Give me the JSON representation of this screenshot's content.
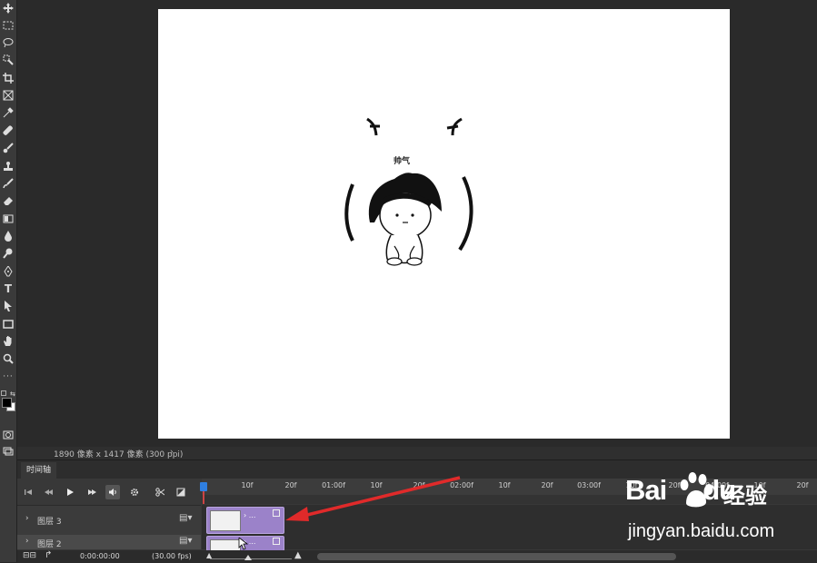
{
  "canvas": {
    "caption": "帅气",
    "background": "#ffffff"
  },
  "status_bar": {
    "doc_info": "1890 像素 x 1417 像素 (300 ppi)",
    "arrow": "›"
  },
  "timeline": {
    "tab_label": "时间轴",
    "ruler_labels": [
      "10f",
      "20f",
      "01:00f",
      "10f",
      "20f",
      "02:00f",
      "10f",
      "20f",
      "03:00f",
      "10f",
      "20f",
      "04:00f",
      "10f",
      "20f"
    ],
    "layers": [
      {
        "name": "图层 3",
        "chevron": "›"
      },
      {
        "name": "图层 2",
        "chevron": "›"
      }
    ],
    "current_time": "0:00:00:00",
    "fps": "(30.00 fps)",
    "clip_label": "› ...",
    "accent_color": "#9b82c9",
    "playhead_color": "#2f7fe0"
  },
  "watermark": {
    "brand": "Bai",
    "brand_suffix": "du",
    "product": "经验",
    "url": "jingyan.baidu.com"
  },
  "annotation": {
    "arrow_color": "#e02a2a"
  }
}
